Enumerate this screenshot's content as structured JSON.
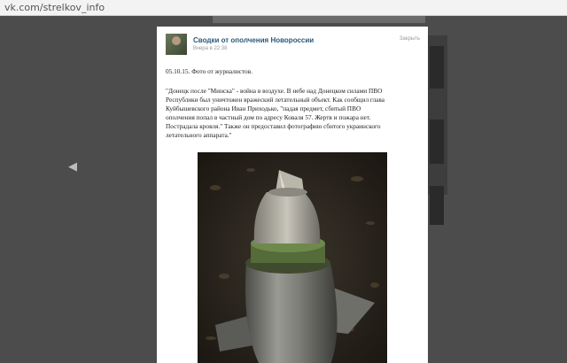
{
  "browser": {
    "url": "vk.com/strelkov_info"
  },
  "post": {
    "group_name": "Сводки от ополчения Новороссии",
    "time": "Вчера в 22:38",
    "close_label": "Закрыть",
    "date_line": "05.10.15. Фото от журналистов.",
    "body_lines": [
      "\"Донецк после \"Минска\" - война в воздухе. В небе над Донецком силами ПВО",
      "Республики был уничтожен вражеский летательный объект. Как сообщил глава",
      "Куйбышевского района Иван Приходько, \"падая предмет, сбитый ПВО",
      "ополчения попал в частный дом по адресу Коваля 57. Жертв и пожара нет.",
      "Пострадала кровля.\" Также он предоставил фотографию сбитого украинского",
      "летательного аппарата.\""
    ]
  },
  "icons": {
    "prev": "chevron-left-icon",
    "next": "chevron-right-icon"
  }
}
